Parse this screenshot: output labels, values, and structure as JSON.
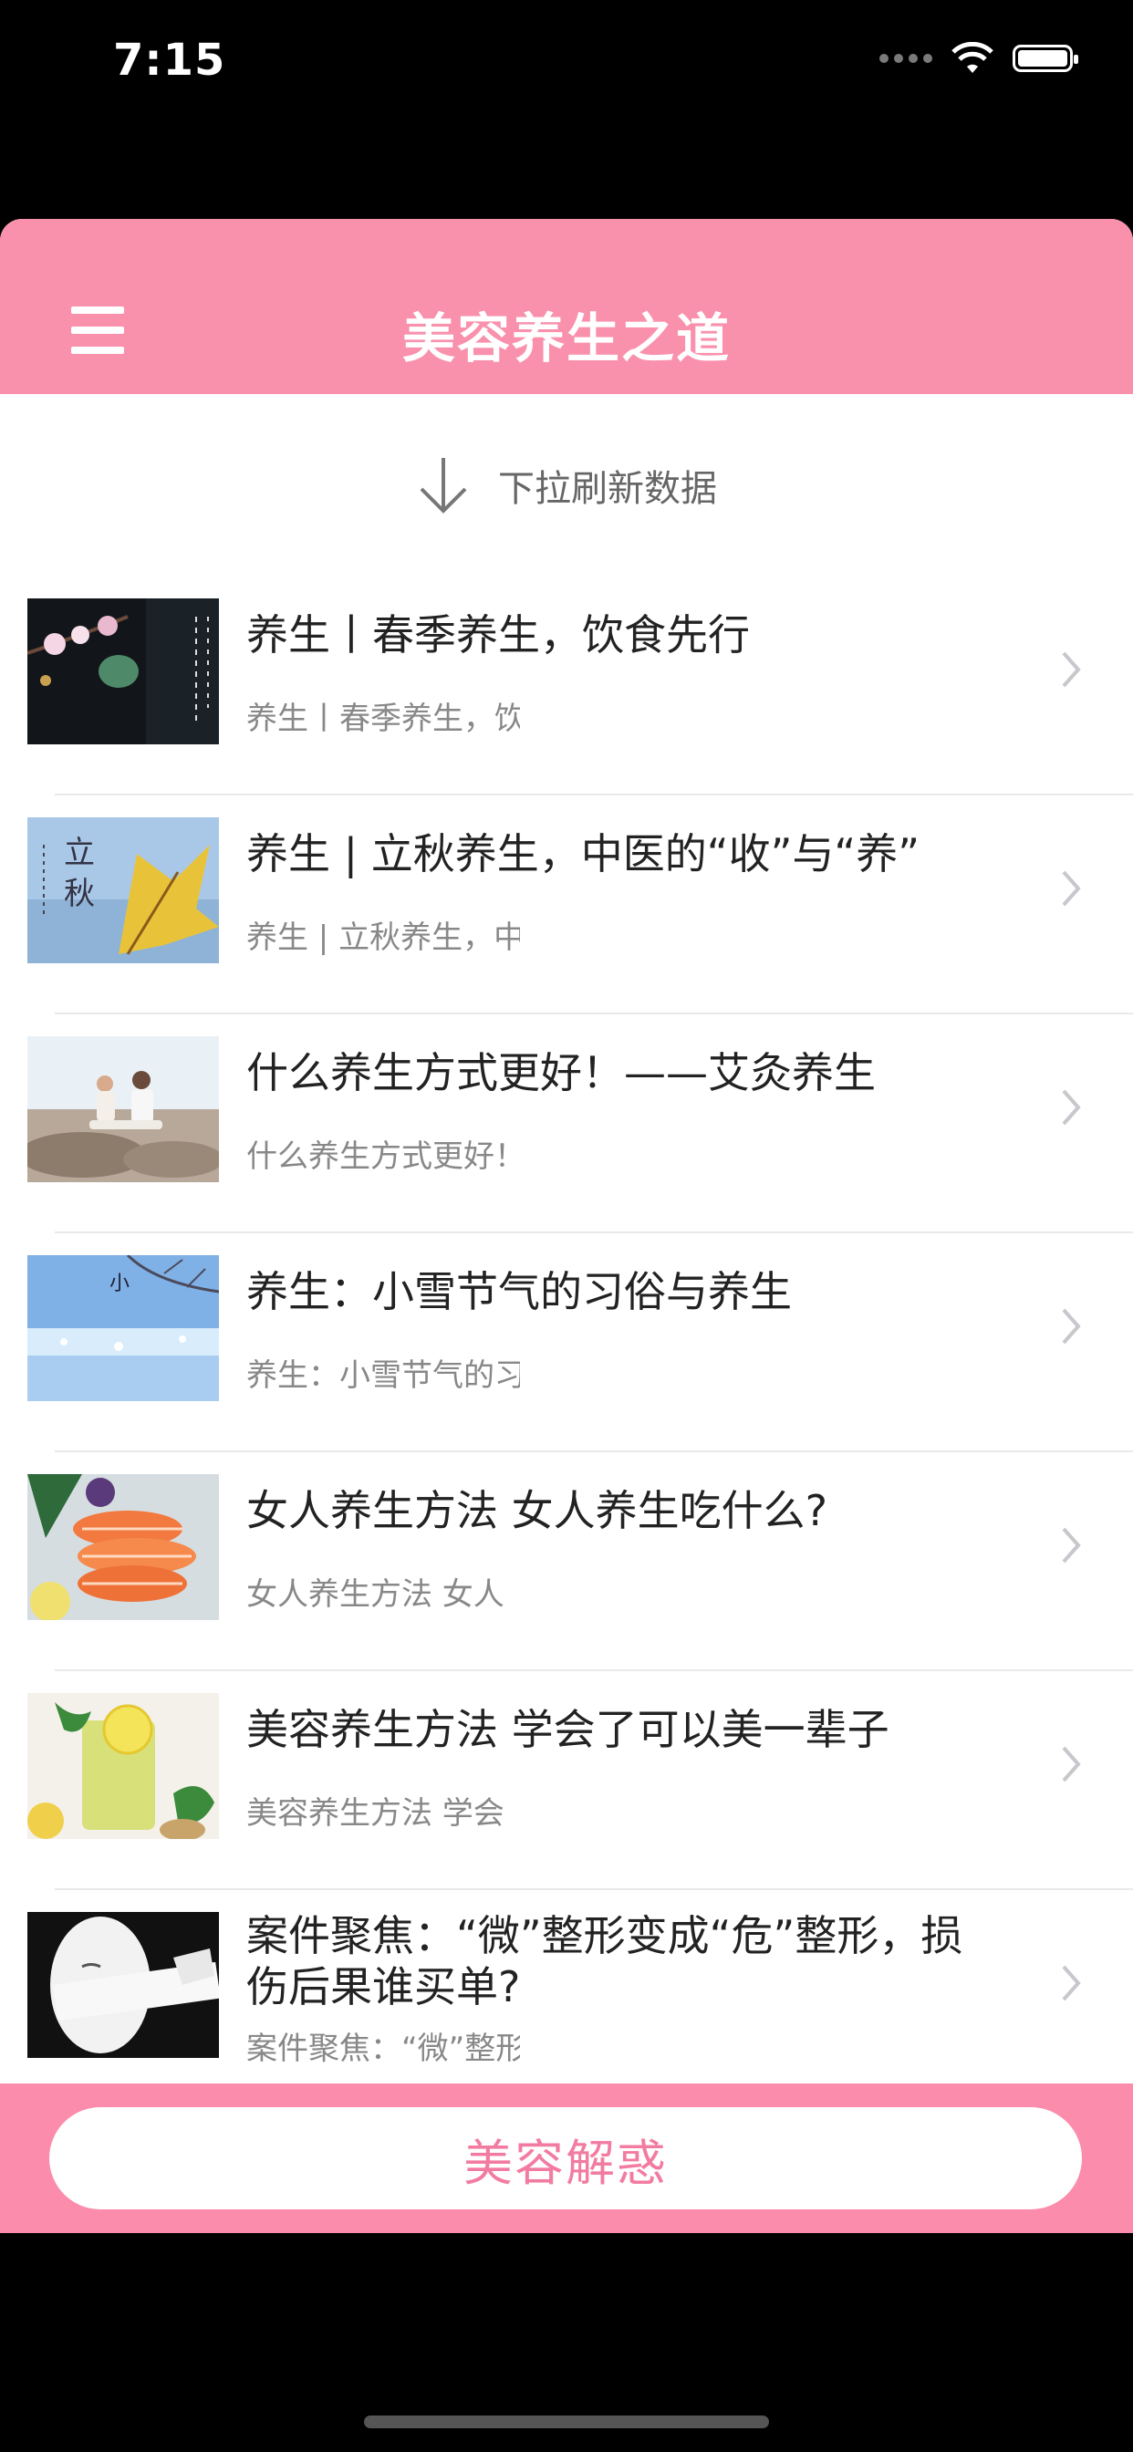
{
  "status_bar": {
    "time": "7:15"
  },
  "nav": {
    "title": "美容养生之道"
  },
  "refresh": {
    "label": "下拉刷新数据"
  },
  "articles": [
    {
      "title": "养生丨春季养生，饮食先行",
      "subtitle": "养生丨春季养生，饮",
      "thumb": "spring-flowers-thumbnail"
    },
    {
      "title": "养生 | 立秋养生，中医的“收”与“养”",
      "subtitle": "养生 | 立秋养生，中",
      "thumb": "autumn-leaf-thumbnail"
    },
    {
      "title": "什么养生方式更好！——艾灸养生",
      "subtitle": "什么养生方式更好！",
      "thumb": "beach-yoga-thumbnail"
    },
    {
      "title": "养生：小雪节气的习俗与养生",
      "subtitle": "养生：小雪节气的习",
      "thumb": "snow-branch-thumbnail"
    },
    {
      "title": "女人养生方法 女人养生吃什么?",
      "subtitle": "女人养生方法 女人",
      "thumb": "salmon-dish-thumbnail"
    },
    {
      "title": "美容养生方法 学会了可以美一辈子",
      "subtitle": "美容养生方法 学会",
      "thumb": "lemon-drink-thumbnail"
    },
    {
      "title": "案件聚焦：“微”整形变成“危”整形，损伤后果谁买单?",
      "subtitle": "案件聚焦：“微”整形",
      "thumb": "face-bandage-thumbnail"
    }
  ],
  "bottom": {
    "button_label": "美容解惑"
  },
  "colors": {
    "nav": "#f991ad",
    "bottom_bar": "#fb8cab",
    "button_text": "#f27ca1"
  }
}
